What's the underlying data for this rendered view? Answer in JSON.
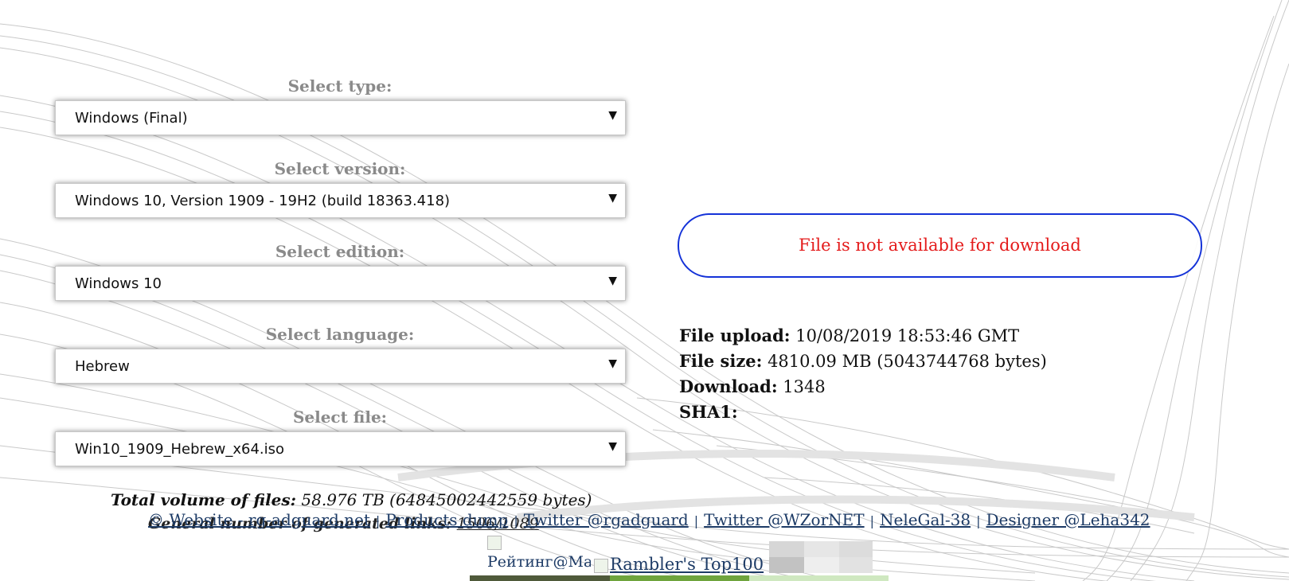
{
  "form": {
    "type_label": "Select type:",
    "type_value": "Windows (Final)",
    "version_label": "Select version:",
    "version_value": "Windows 10, Version 1909 - 19H2 (build 18363.418)",
    "edition_label": "Select edition:",
    "edition_value": "Windows 10",
    "language_label": "Select language:",
    "language_value": "Hebrew",
    "file_label": "Select file:",
    "file_value": "Win10_1909_Hebrew_x64.iso",
    "arrow": "▼"
  },
  "status": {
    "message": "File is not available for download",
    "border_color": "#1432d8",
    "text_color": "#e41b1b"
  },
  "file_info": {
    "upload_label": "File upload:",
    "upload_value": "10/08/2019 18:53:46 GMT",
    "size_label": "File size:",
    "size_value": "4810.09 MB (5043744768 bytes)",
    "download_label": "Download:",
    "download_value": "1348",
    "sha1_label": "SHA1:",
    "sha1_value": ""
  },
  "totals": {
    "volume_label": "Total volume of files:",
    "volume_value": "58.976 TB (64845002442559 bytes)",
    "links_label": "General number of generated links:",
    "links_value": "1506/1089"
  },
  "footer": {
    "links": [
      "© Website - rg-adguard.net",
      "Products dump",
      "Twitter @rgadguard",
      "Twitter @WZorNET",
      "NeleGal-38",
      "Designer @Leha342"
    ],
    "separator": "|"
  },
  "counters": {
    "rating_alt": "Рейтинг@Mail.ru",
    "rambler_alt": "Rambler's Top100"
  }
}
